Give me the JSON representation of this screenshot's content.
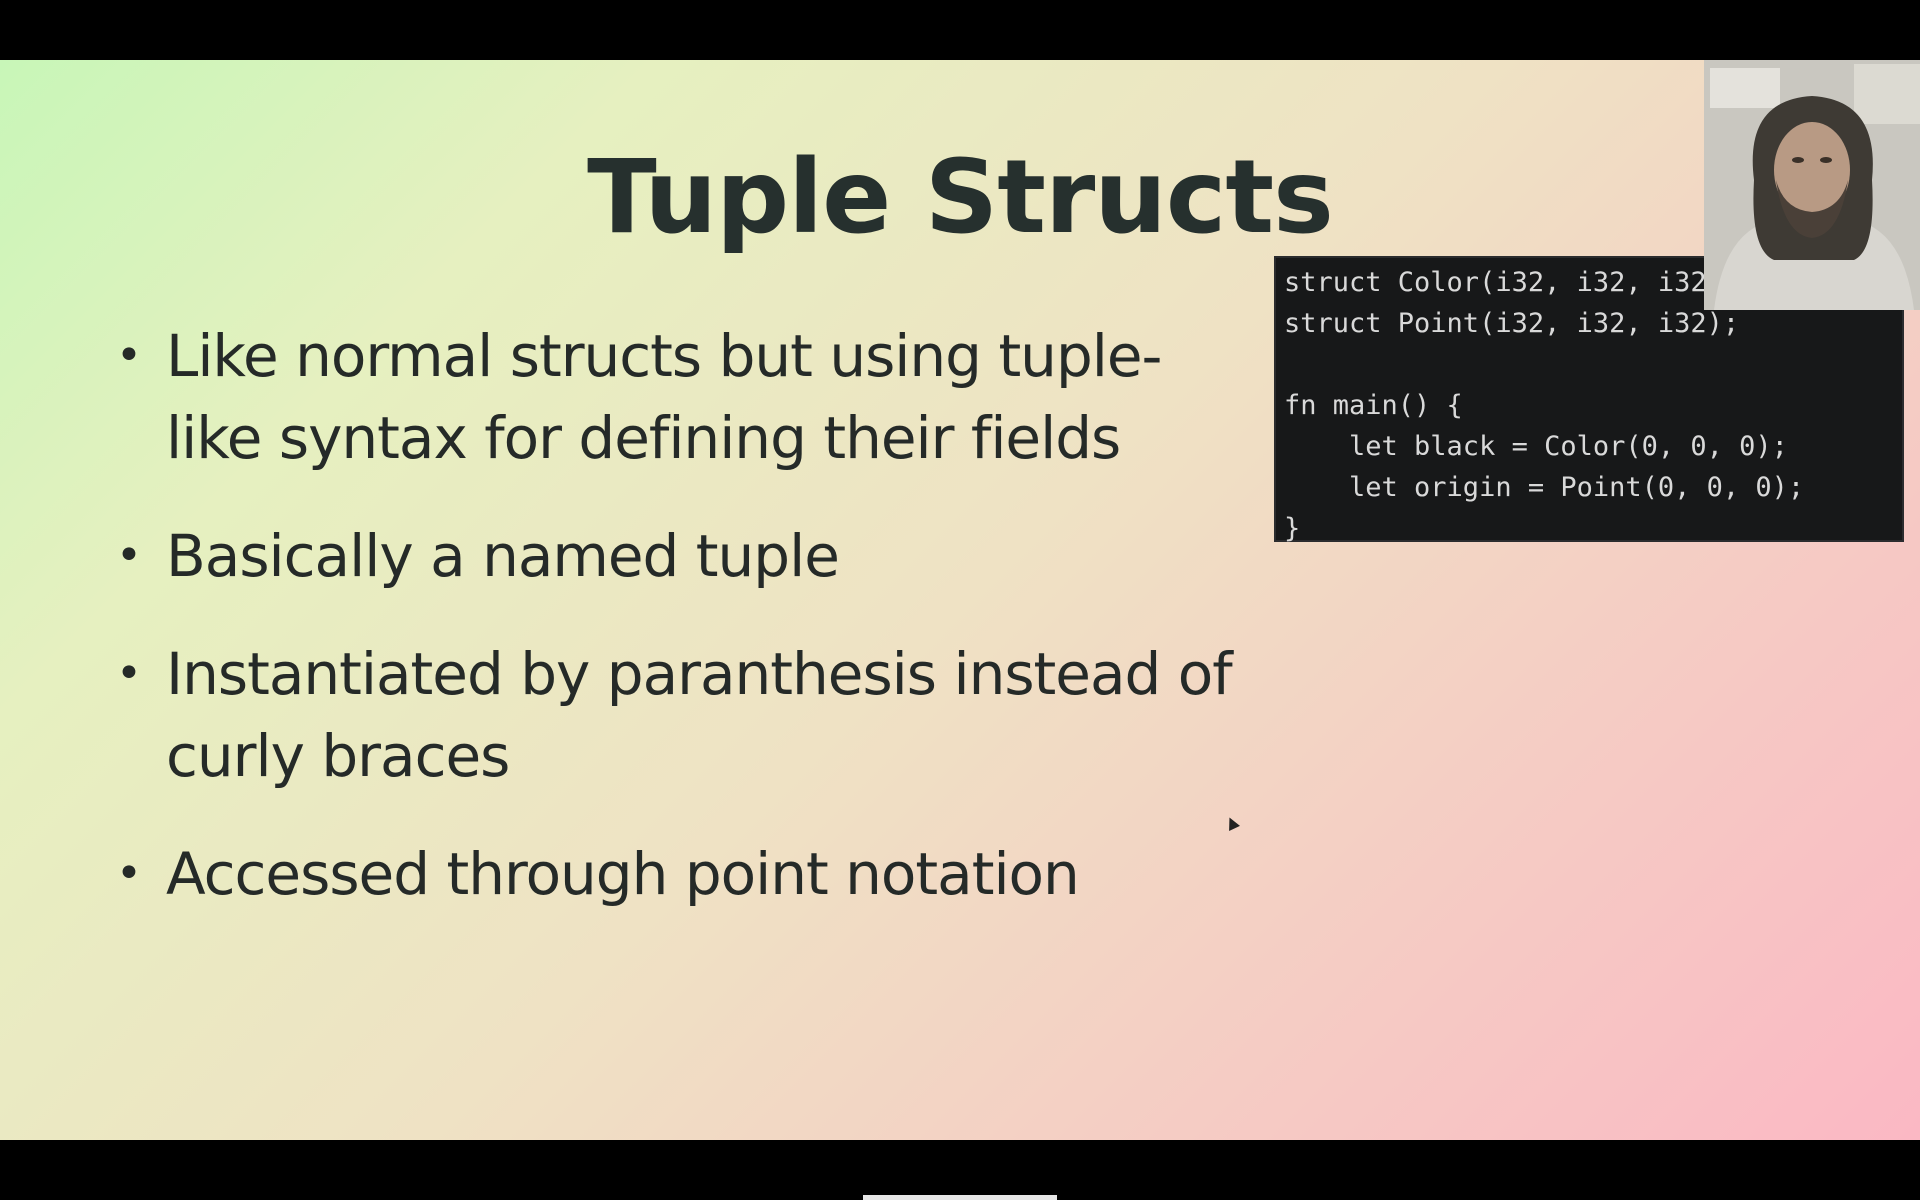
{
  "slide": {
    "title": "Tuple Structs",
    "bullets": [
      "Like normal structs but using tuple-like syntax for defining their fields",
      "Basically a named tuple",
      "Instantiated by paranthesis instead of curly braces",
      "Accessed through point notation"
    ],
    "bullet_marker": "•",
    "code": [
      "struct Color(i32, i32, i32);",
      "struct Point(i32, i32, i32);",
      "",
      "fn main() {",
      "    let black = Color(0, 0, 0);",
      "    let origin = Point(0, 0, 0);",
      "}"
    ]
  },
  "colors": {
    "title": "#26302e",
    "code_background": "#171819",
    "code_text": "#d9d9d9",
    "gradient_start": "#c8f6b8",
    "gradient_end": "#fbb8c4"
  },
  "webcam": {
    "icon": "presenter-video-icon"
  }
}
